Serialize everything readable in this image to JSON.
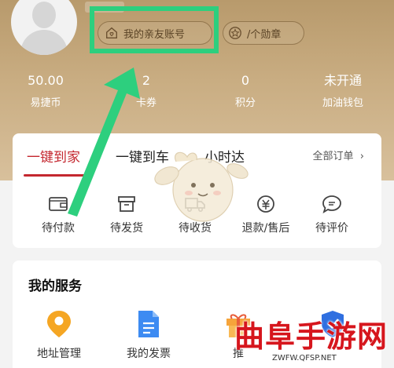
{
  "header": {
    "relatives_account_label": "我的亲友账号",
    "medals_label": "/个勋章"
  },
  "stats": [
    {
      "value": "50.00",
      "label": "易捷币"
    },
    {
      "value": "2",
      "label": "卡券"
    },
    {
      "value": "0",
      "label": "积分"
    },
    {
      "value": "未开通",
      "label": "加油钱包"
    }
  ],
  "orders": {
    "tabs": [
      "一键到家",
      "一键到车",
      "小时达"
    ],
    "all_orders_label": "全部订单",
    "items": [
      {
        "label": "待付款",
        "icon": "wallet-icon"
      },
      {
        "label": "待发货",
        "icon": "box-icon"
      },
      {
        "label": "待收货",
        "icon": "truck-icon"
      },
      {
        "label": "退款/售后",
        "icon": "refund-icon"
      },
      {
        "label": "待评价",
        "icon": "comment-icon"
      }
    ]
  },
  "services": {
    "title": "我的服务",
    "items": [
      {
        "label": "地址管理",
        "icon": "location-pin-icon"
      },
      {
        "label": "我的发票",
        "icon": "invoice-icon"
      },
      {
        "label": "推",
        "icon": "gift-icon"
      },
      {
        "label": "",
        "icon": "shield-icon"
      }
    ]
  },
  "watermark": {
    "title": "曲阜手游网",
    "url": "ZWFW.QFSP.NET"
  },
  "colors": {
    "accent": "#c4272f",
    "header": "#c9ad82",
    "highlight": "#2dcf7e"
  }
}
